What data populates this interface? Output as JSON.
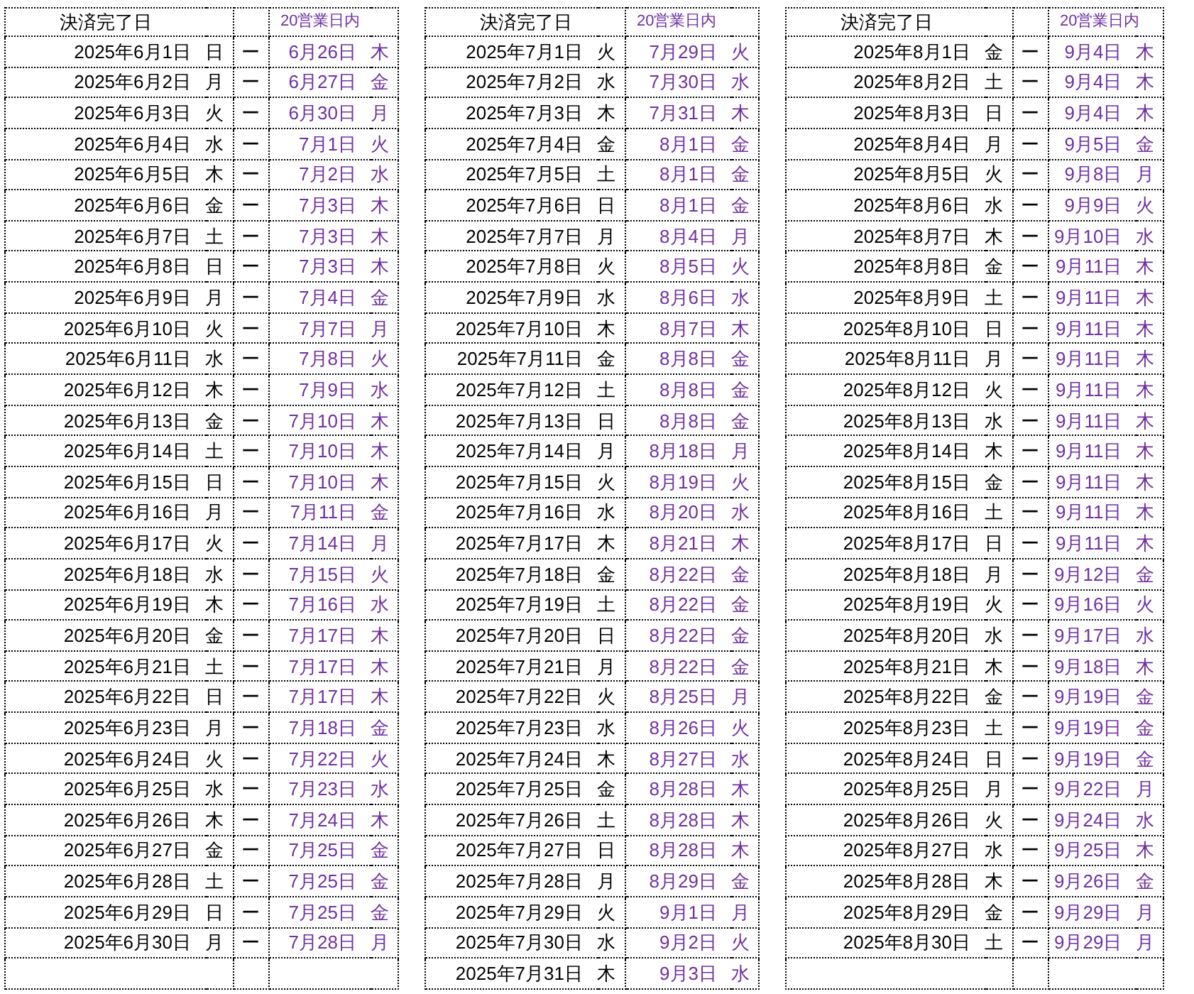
{
  "tables": [
    {
      "header_left": "決済完了日",
      "header_right": "20営業日内",
      "has_arrow_column": true,
      "rows": [
        {
          "kind": "entry",
          "date": "2025年6月1日",
          "weekday": "日",
          "arrow": "ー",
          "due_date": "6月26日",
          "due_weekday": "木"
        },
        {
          "kind": "entry",
          "date": "2025年6月2日",
          "weekday": "月",
          "arrow": "ー",
          "due_date": "6月27日",
          "due_weekday": "金"
        },
        {
          "kind": "entry",
          "date": "2025年6月3日",
          "weekday": "火",
          "arrow": "ー",
          "due_date": "6月30日",
          "due_weekday": "月"
        },
        {
          "kind": "entry",
          "date": "2025年6月4日",
          "weekday": "水",
          "arrow": "ー",
          "due_date": "7月1日",
          "due_weekday": "火"
        },
        {
          "kind": "entry",
          "date": "2025年6月5日",
          "weekday": "木",
          "arrow": "ー",
          "due_date": "7月2日",
          "due_weekday": "水"
        },
        {
          "kind": "entry",
          "date": "2025年6月6日",
          "weekday": "金",
          "arrow": "ー",
          "due_date": "7月3日",
          "due_weekday": "木"
        },
        {
          "kind": "entry",
          "date": "2025年6月7日",
          "weekday": "土",
          "arrow": "ー",
          "due_date": "7月3日",
          "due_weekday": "木"
        },
        {
          "kind": "entry",
          "date": "2025年6月8日",
          "weekday": "日",
          "arrow": "ー",
          "due_date": "7月3日",
          "due_weekday": "木"
        },
        {
          "kind": "entry",
          "date": "2025年6月9日",
          "weekday": "月",
          "arrow": "ー",
          "due_date": "7月4日",
          "due_weekday": "金"
        },
        {
          "kind": "entry",
          "date": "2025年6月10日",
          "weekday": "火",
          "arrow": "ー",
          "due_date": "7月7日",
          "due_weekday": "月"
        },
        {
          "kind": "entry",
          "date": "2025年6月11日",
          "weekday": "水",
          "arrow": "ー",
          "due_date": "7月8日",
          "due_weekday": "火"
        },
        {
          "kind": "entry",
          "date": "2025年6月12日",
          "weekday": "木",
          "arrow": "ー",
          "due_date": "7月9日",
          "due_weekday": "水"
        },
        {
          "kind": "entry",
          "date": "2025年6月13日",
          "weekday": "金",
          "arrow": "ー",
          "due_date": "7月10日",
          "due_weekday": "木"
        },
        {
          "kind": "entry",
          "date": "2025年6月14日",
          "weekday": "土",
          "arrow": "ー",
          "due_date": "7月10日",
          "due_weekday": "木"
        },
        {
          "kind": "entry",
          "date": "2025年6月15日",
          "weekday": "日",
          "arrow": "ー",
          "due_date": "7月10日",
          "due_weekday": "木"
        },
        {
          "kind": "entry",
          "date": "2025年6月16日",
          "weekday": "月",
          "arrow": "ー",
          "due_date": "7月11日",
          "due_weekday": "金"
        },
        {
          "kind": "entry",
          "date": "2025年6月17日",
          "weekday": "火",
          "arrow": "ー",
          "due_date": "7月14日",
          "due_weekday": "月"
        },
        {
          "kind": "entry",
          "date": "2025年6月18日",
          "weekday": "水",
          "arrow": "ー",
          "due_date": "7月15日",
          "due_weekday": "火"
        },
        {
          "kind": "entry",
          "date": "2025年6月19日",
          "weekday": "木",
          "arrow": "ー",
          "due_date": "7月16日",
          "due_weekday": "水"
        },
        {
          "kind": "entry",
          "date": "2025年6月20日",
          "weekday": "金",
          "arrow": "ー",
          "due_date": "7月17日",
          "due_weekday": "木"
        },
        {
          "kind": "entry",
          "date": "2025年6月21日",
          "weekday": "土",
          "arrow": "ー",
          "due_date": "7月17日",
          "due_weekday": "木"
        },
        {
          "kind": "entry",
          "date": "2025年6月22日",
          "weekday": "日",
          "arrow": "ー",
          "due_date": "7月17日",
          "due_weekday": "木"
        },
        {
          "kind": "entry",
          "date": "2025年6月23日",
          "weekday": "月",
          "arrow": "ー",
          "due_date": "7月18日",
          "due_weekday": "金"
        },
        {
          "kind": "entry",
          "date": "2025年6月24日",
          "weekday": "火",
          "arrow": "ー",
          "due_date": "7月22日",
          "due_weekday": "火"
        },
        {
          "kind": "entry",
          "date": "2025年6月25日",
          "weekday": "水",
          "arrow": "ー",
          "due_date": "7月23日",
          "due_weekday": "水"
        },
        {
          "kind": "entry",
          "date": "2025年6月26日",
          "weekday": "木",
          "arrow": "ー",
          "due_date": "7月24日",
          "due_weekday": "木"
        },
        {
          "kind": "entry",
          "date": "2025年6月27日",
          "weekday": "金",
          "arrow": "ー",
          "due_date": "7月25日",
          "due_weekday": "金"
        },
        {
          "kind": "entry",
          "date": "2025年6月28日",
          "weekday": "土",
          "arrow": "ー",
          "due_date": "7月25日",
          "due_weekday": "金"
        },
        {
          "kind": "entry",
          "date": "2025年6月29日",
          "weekday": "日",
          "arrow": "ー",
          "due_date": "7月25日",
          "due_weekday": "金"
        },
        {
          "kind": "entry",
          "date": "2025年6月30日",
          "weekday": "月",
          "arrow": "ー",
          "due_date": "7月28日",
          "due_weekday": "月"
        },
        {
          "kind": "empty"
        }
      ]
    },
    {
      "header_left": "決済完了日",
      "header_right": "20営業日内",
      "has_arrow_column": false,
      "rows": [
        {
          "kind": "entry",
          "date": "2025年7月1日",
          "weekday": "火",
          "due_date": "7月29日",
          "due_weekday": "火"
        },
        {
          "kind": "entry",
          "date": "2025年7月2日",
          "weekday": "水",
          "due_date": "7月30日",
          "due_weekday": "水"
        },
        {
          "kind": "entry",
          "date": "2025年7月3日",
          "weekday": "木",
          "due_date": "7月31日",
          "due_weekday": "木"
        },
        {
          "kind": "entry",
          "date": "2025年7月4日",
          "weekday": "金",
          "due_date": "8月1日",
          "due_weekday": "金"
        },
        {
          "kind": "entry",
          "date": "2025年7月5日",
          "weekday": "土",
          "due_date": "8月1日",
          "due_weekday": "金"
        },
        {
          "kind": "entry",
          "date": "2025年7月6日",
          "weekday": "日",
          "due_date": "8月1日",
          "due_weekday": "金"
        },
        {
          "kind": "entry",
          "date": "2025年7月7日",
          "weekday": "月",
          "due_date": "8月4日",
          "due_weekday": "月"
        },
        {
          "kind": "entry",
          "date": "2025年7月8日",
          "weekday": "火",
          "due_date": "8月5日",
          "due_weekday": "火"
        },
        {
          "kind": "entry",
          "date": "2025年7月9日",
          "weekday": "水",
          "due_date": "8月6日",
          "due_weekday": "水"
        },
        {
          "kind": "entry",
          "date": "2025年7月10日",
          "weekday": "木",
          "due_date": "8月7日",
          "due_weekday": "木"
        },
        {
          "kind": "entry",
          "date": "2025年7月11日",
          "weekday": "金",
          "due_date": "8月8日",
          "due_weekday": "金"
        },
        {
          "kind": "entry",
          "date": "2025年7月12日",
          "weekday": "土",
          "due_date": "8月8日",
          "due_weekday": "金"
        },
        {
          "kind": "entry",
          "date": "2025年7月13日",
          "weekday": "日",
          "due_date": "8月8日",
          "due_weekday": "金"
        },
        {
          "kind": "entry",
          "date": "2025年7月14日",
          "weekday": "月",
          "due_date": "8月18日",
          "due_weekday": "月"
        },
        {
          "kind": "entry",
          "date": "2025年7月15日",
          "weekday": "火",
          "due_date": "8月19日",
          "due_weekday": "火"
        },
        {
          "kind": "entry",
          "date": "2025年7月16日",
          "weekday": "水",
          "due_date": "8月20日",
          "due_weekday": "水"
        },
        {
          "kind": "entry",
          "date": "2025年7月17日",
          "weekday": "木",
          "due_date": "8月21日",
          "due_weekday": "木"
        },
        {
          "kind": "entry",
          "date": "2025年7月18日",
          "weekday": "金",
          "due_date": "8月22日",
          "due_weekday": "金"
        },
        {
          "kind": "entry",
          "date": "2025年7月19日",
          "weekday": "土",
          "due_date": "8月22日",
          "due_weekday": "金"
        },
        {
          "kind": "entry",
          "date": "2025年7月20日",
          "weekday": "日",
          "due_date": "8月22日",
          "due_weekday": "金"
        },
        {
          "kind": "entry",
          "date": "2025年7月21日",
          "weekday": "月",
          "due_date": "8月22日",
          "due_weekday": "金"
        },
        {
          "kind": "entry",
          "date": "2025年7月22日",
          "weekday": "火",
          "due_date": "8月25日",
          "due_weekday": "月"
        },
        {
          "kind": "entry",
          "date": "2025年7月23日",
          "weekday": "水",
          "due_date": "8月26日",
          "due_weekday": "火"
        },
        {
          "kind": "entry",
          "date": "2025年7月24日",
          "weekday": "木",
          "due_date": "8月27日",
          "due_weekday": "水"
        },
        {
          "kind": "entry",
          "date": "2025年7月25日",
          "weekday": "金",
          "due_date": "8月28日",
          "due_weekday": "木"
        },
        {
          "kind": "entry",
          "date": "2025年7月26日",
          "weekday": "土",
          "due_date": "8月28日",
          "due_weekday": "木"
        },
        {
          "kind": "entry",
          "date": "2025年7月27日",
          "weekday": "日",
          "due_date": "8月28日",
          "due_weekday": "木"
        },
        {
          "kind": "entry",
          "date": "2025年7月28日",
          "weekday": "月",
          "due_date": "8月29日",
          "due_weekday": "金"
        },
        {
          "kind": "entry",
          "date": "2025年7月29日",
          "weekday": "火",
          "due_date": "9月1日",
          "due_weekday": "月"
        },
        {
          "kind": "entry",
          "date": "2025年7月30日",
          "weekday": "水",
          "due_date": "9月2日",
          "due_weekday": "火"
        },
        {
          "kind": "entry",
          "date": "2025年7月31日",
          "weekday": "木",
          "due_date": "9月3日",
          "due_weekday": "水"
        }
      ]
    },
    {
      "header_left": "決済完了日",
      "header_right": "20営業日内",
      "has_arrow_column": true,
      "rows": [
        {
          "kind": "entry",
          "date": "2025年8月1日",
          "weekday": "金",
          "arrow": "ー",
          "due_date": "9月4日",
          "due_weekday": "木"
        },
        {
          "kind": "entry",
          "date": "2025年8月2日",
          "weekday": "土",
          "arrow": "ー",
          "due_date": "9月4日",
          "due_weekday": "木"
        },
        {
          "kind": "entry",
          "date": "2025年8月3日",
          "weekday": "日",
          "arrow": "ー",
          "due_date": "9月4日",
          "due_weekday": "木"
        },
        {
          "kind": "entry",
          "date": "2025年8月4日",
          "weekday": "月",
          "arrow": "ー",
          "due_date": "9月5日",
          "due_weekday": "金"
        },
        {
          "kind": "entry",
          "date": "2025年8月5日",
          "weekday": "火",
          "arrow": "ー",
          "due_date": "9月8日",
          "due_weekday": "月"
        },
        {
          "kind": "entry",
          "date": "2025年8月6日",
          "weekday": "水",
          "arrow": "ー",
          "due_date": "9月9日",
          "due_weekday": "火"
        },
        {
          "kind": "entry",
          "date": "2025年8月7日",
          "weekday": "木",
          "arrow": "ー",
          "due_date": "9月10日",
          "due_weekday": "水"
        },
        {
          "kind": "entry",
          "date": "2025年8月8日",
          "weekday": "金",
          "arrow": "ー",
          "due_date": "9月11日",
          "due_weekday": "木"
        },
        {
          "kind": "entry",
          "date": "2025年8月9日",
          "weekday": "土",
          "arrow": "ー",
          "due_date": "9月11日",
          "due_weekday": "木"
        },
        {
          "kind": "entry",
          "date": "2025年8月10日",
          "weekday": "日",
          "arrow": "ー",
          "due_date": "9月11日",
          "due_weekday": "木"
        },
        {
          "kind": "entry",
          "date": "2025年8月11日",
          "weekday": "月",
          "arrow": "ー",
          "due_date": "9月11日",
          "due_weekday": "木"
        },
        {
          "kind": "entry",
          "date": "2025年8月12日",
          "weekday": "火",
          "arrow": "ー",
          "due_date": "9月11日",
          "due_weekday": "木"
        },
        {
          "kind": "entry",
          "date": "2025年8月13日",
          "weekday": "水",
          "arrow": "ー",
          "due_date": "9月11日",
          "due_weekday": "木"
        },
        {
          "kind": "entry",
          "date": "2025年8月14日",
          "weekday": "木",
          "arrow": "ー",
          "due_date": "9月11日",
          "due_weekday": "木"
        },
        {
          "kind": "entry",
          "date": "2025年8月15日",
          "weekday": "金",
          "arrow": "ー",
          "due_date": "9月11日",
          "due_weekday": "木"
        },
        {
          "kind": "entry",
          "date": "2025年8月16日",
          "weekday": "土",
          "arrow": "ー",
          "due_date": "9月11日",
          "due_weekday": "木"
        },
        {
          "kind": "entry",
          "date": "2025年8月17日",
          "weekday": "日",
          "arrow": "ー",
          "due_date": "9月11日",
          "due_weekday": "木"
        },
        {
          "kind": "entry",
          "date": "2025年8月18日",
          "weekday": "月",
          "arrow": "ー",
          "due_date": "9月12日",
          "due_weekday": "金"
        },
        {
          "kind": "entry",
          "date": "2025年8月19日",
          "weekday": "火",
          "arrow": "ー",
          "due_date": "9月16日",
          "due_weekday": "火"
        },
        {
          "kind": "entry",
          "date": "2025年8月20日",
          "weekday": "水",
          "arrow": "ー",
          "due_date": "9月17日",
          "due_weekday": "水"
        },
        {
          "kind": "entry",
          "date": "2025年8月21日",
          "weekday": "木",
          "arrow": "ー",
          "due_date": "9月18日",
          "due_weekday": "木"
        },
        {
          "kind": "entry",
          "date": "2025年8月22日",
          "weekday": "金",
          "arrow": "ー",
          "due_date": "9月19日",
          "due_weekday": "金"
        },
        {
          "kind": "entry",
          "date": "2025年8月23日",
          "weekday": "土",
          "arrow": "ー",
          "due_date": "9月19日",
          "due_weekday": "金"
        },
        {
          "kind": "entry",
          "date": "2025年8月24日",
          "weekday": "日",
          "arrow": "ー",
          "due_date": "9月19日",
          "due_weekday": "金"
        },
        {
          "kind": "entry",
          "date": "2025年8月25日",
          "weekday": "月",
          "arrow": "ー",
          "due_date": "9月22日",
          "due_weekday": "月"
        },
        {
          "kind": "entry",
          "date": "2025年8月26日",
          "weekday": "火",
          "arrow": "ー",
          "due_date": "9月24日",
          "due_weekday": "水"
        },
        {
          "kind": "entry",
          "date": "2025年8月27日",
          "weekday": "水",
          "arrow": "ー",
          "due_date": "9月25日",
          "due_weekday": "木"
        },
        {
          "kind": "entry",
          "date": "2025年8月28日",
          "weekday": "木",
          "arrow": "ー",
          "due_date": "9月26日",
          "due_weekday": "金"
        },
        {
          "kind": "entry",
          "date": "2025年8月29日",
          "weekday": "金",
          "arrow": "ー",
          "due_date": "9月29日",
          "due_weekday": "月"
        },
        {
          "kind": "entry",
          "date": "2025年8月30日",
          "weekday": "土",
          "arrow": "ー",
          "due_date": "9月29日",
          "due_weekday": "月"
        },
        {
          "kind": "empty"
        }
      ]
    }
  ]
}
